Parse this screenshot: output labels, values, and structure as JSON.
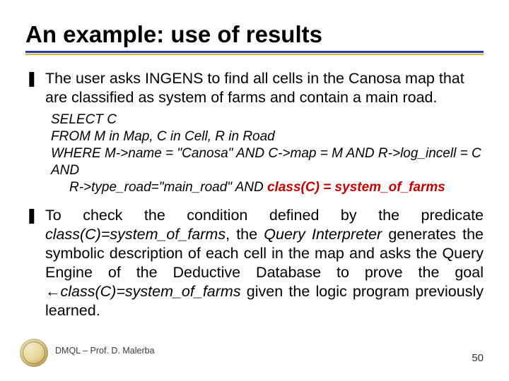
{
  "title": "An example: use of results",
  "bullets": [
    {
      "symbol": "❚",
      "text": "The user asks INGENS to find all cells in the Canosa map that are classified as system of farms and contain a main road.",
      "justify": false
    },
    {
      "symbol": "❚",
      "preText": "To check the condition defined by the predicate ",
      "ital1": "class(C)=system_of_farms",
      "mid1": ", the ",
      "ital2": "Query Interpreter",
      "mid2": " generates the symbolic description of each cell in the map and asks the Query Engine of the Deductive Database to prove the goal ",
      "arrow": "←",
      "ital3": "class(C)=system_of_farms",
      "post": " given the logic program previously learned.",
      "justify": true
    }
  ],
  "code": {
    "l1a": "SELECT  C",
    "l2a": "FROM  M in Map, C in Cell, R in Road",
    "l3a": "WHERE M->name = \"Canosa\" AND  C->map = M AND R->log_incell = C AND",
    "l4a": "R->type_road=\"main_road\" AND ",
    "l4pred": "class(C) = system_of_farms"
  },
  "footer": "DMQL – Prof. D. Malerba",
  "page": "50"
}
